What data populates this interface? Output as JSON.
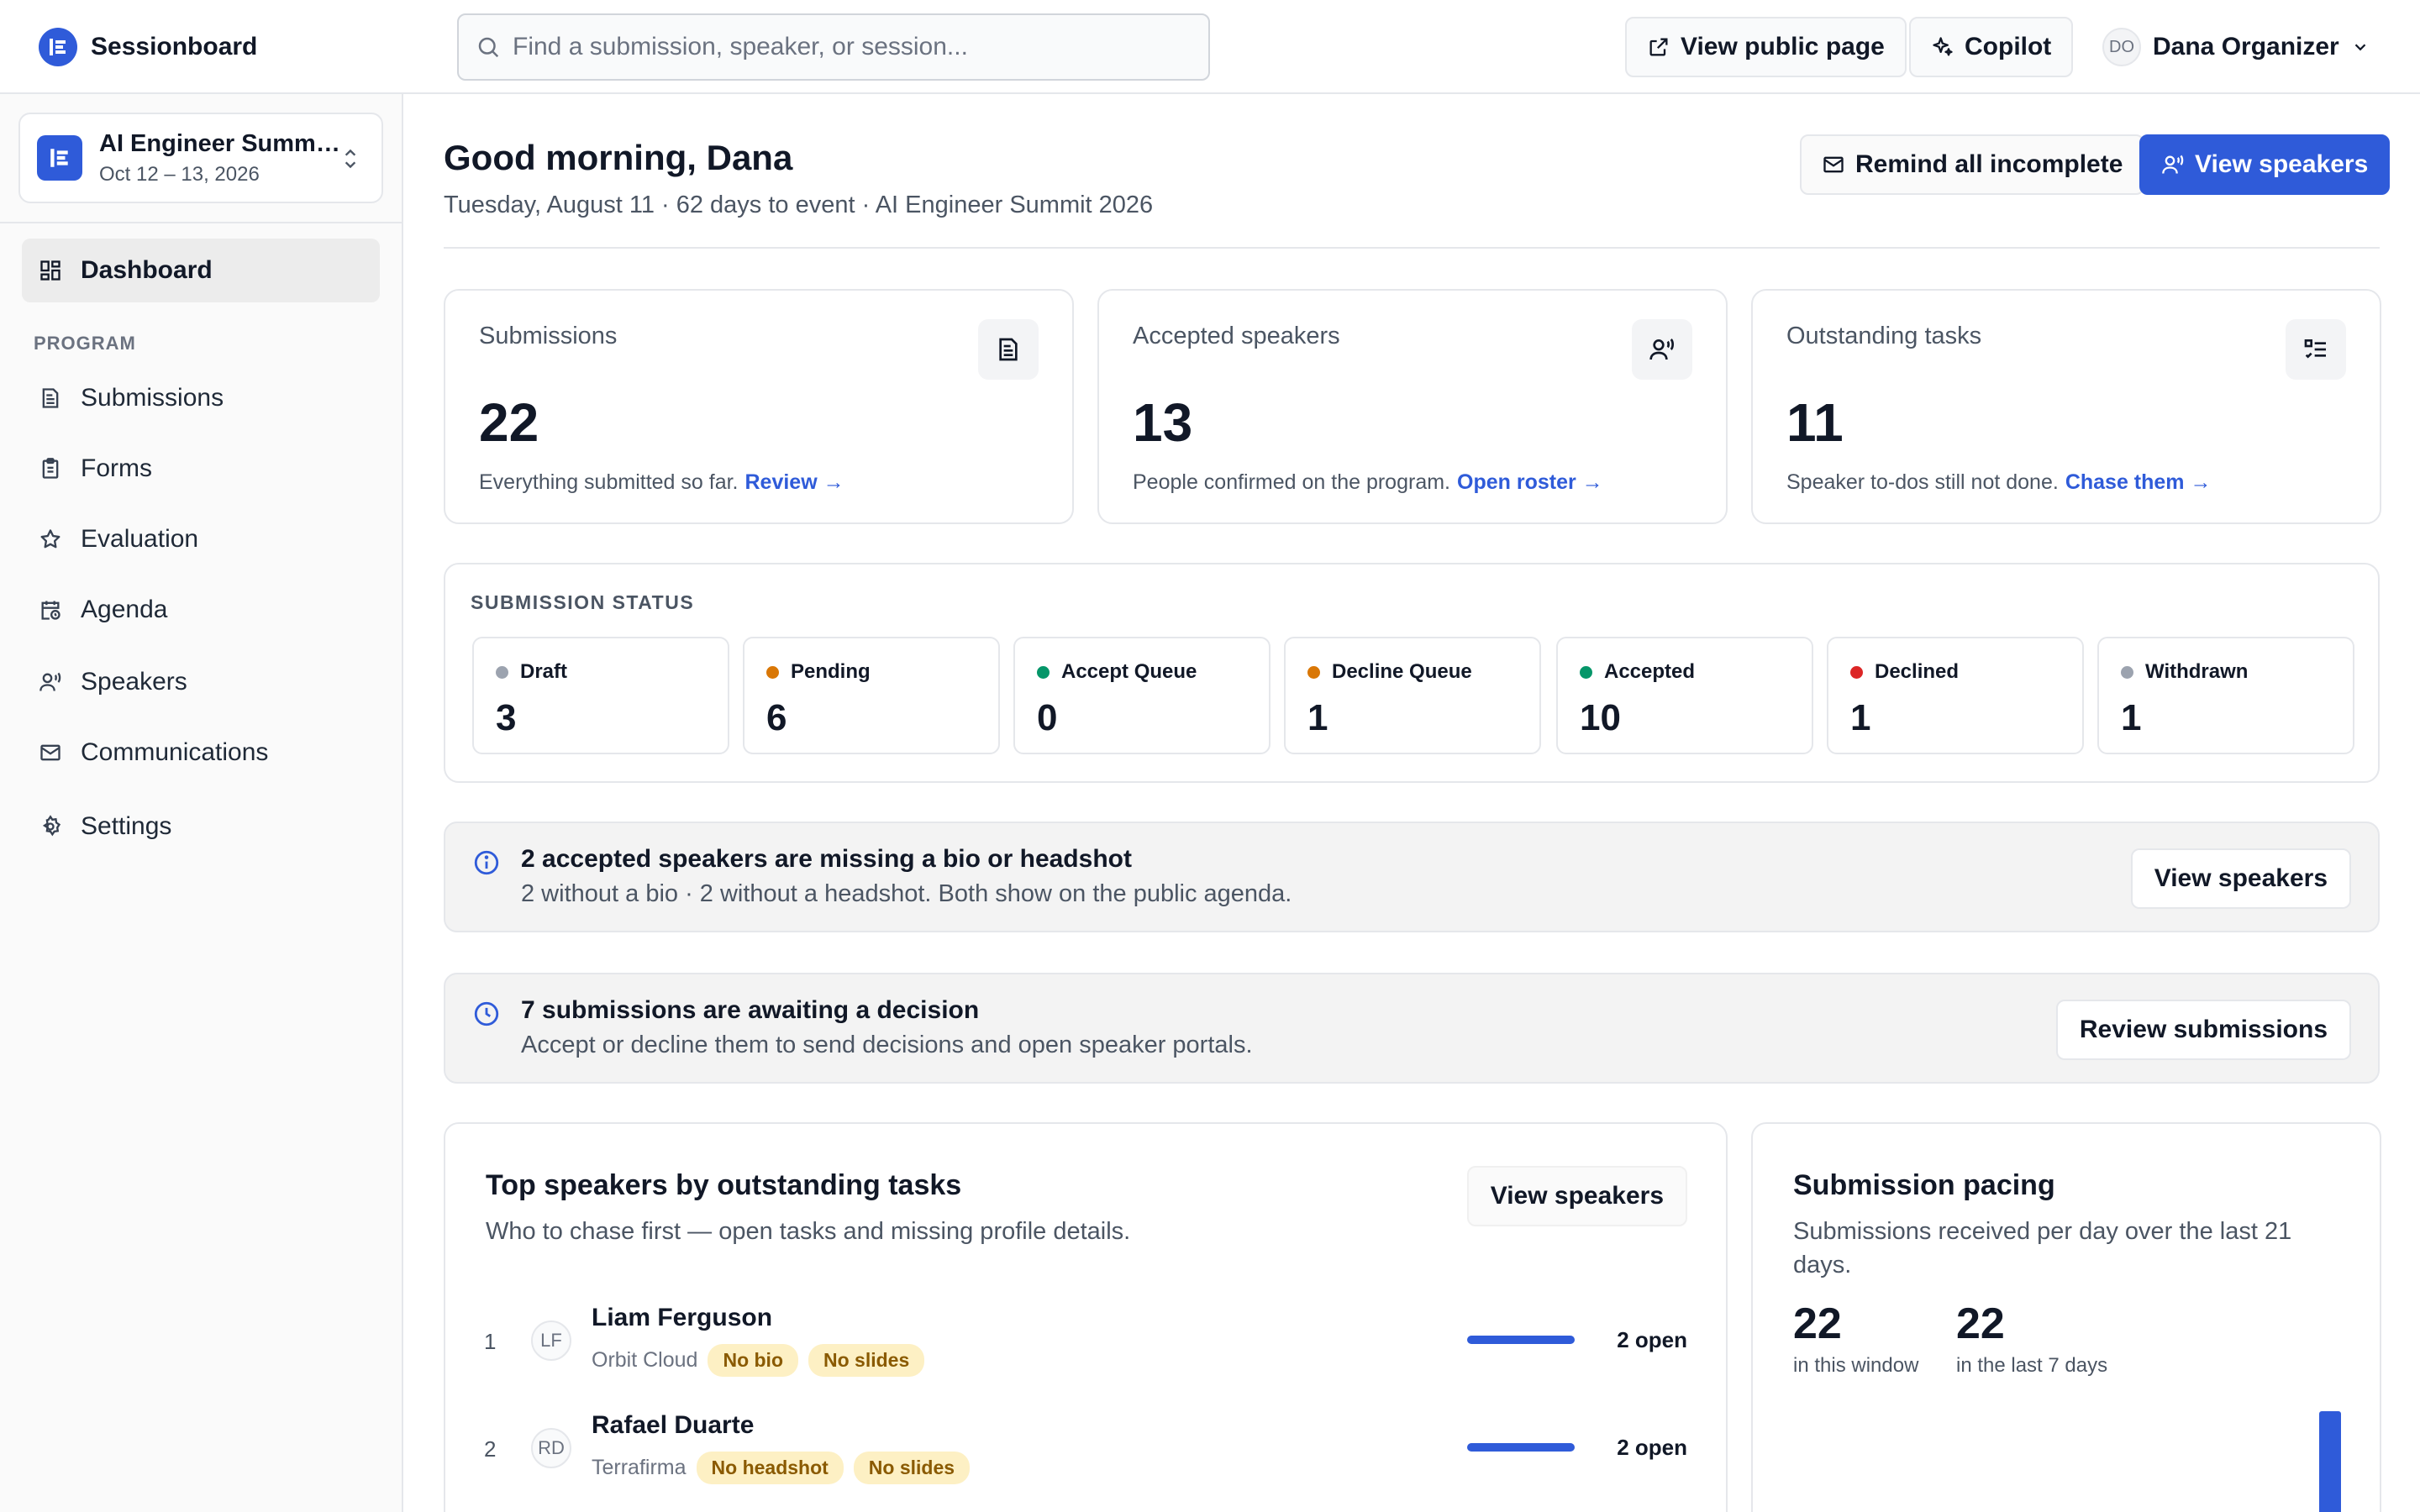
{
  "app": {
    "name": "Sessionboard"
  },
  "search": {
    "placeholder": "Find a submission, speaker, or session..."
  },
  "topbar": {
    "public_page_label": "View public page",
    "copilot_label": "Copilot",
    "user_initials": "DO",
    "user_name": "Dana Organizer"
  },
  "event": {
    "name": "AI Engineer Summit 2026",
    "dates": "Oct 12 – 13, 2026"
  },
  "sidebar": {
    "dashboard": "Dashboard",
    "section_label": "PROGRAM",
    "items": [
      {
        "label": "Submissions",
        "icon": "file-text-icon"
      },
      {
        "label": "Forms",
        "icon": "clipboard-icon"
      },
      {
        "label": "Evaluation",
        "icon": "star-icon"
      },
      {
        "label": "Agenda",
        "icon": "calendar-clock-icon"
      },
      {
        "label": "Speakers",
        "icon": "speaker-icon"
      },
      {
        "label": "Communications",
        "icon": "mail-icon"
      },
      {
        "label": "Settings",
        "icon": "gear-icon"
      }
    ]
  },
  "header": {
    "greeting": "Good morning, Dana",
    "subline": "Tuesday, August 11 · 62 days to event · AI Engineer Summit 2026",
    "remind_label": "Remind all incomplete",
    "view_speakers_label": "View speakers"
  },
  "stats": [
    {
      "title": "Submissions",
      "value": "22",
      "desc": "Everything submitted so far.",
      "link": "Review →",
      "icon": "file-text-icon"
    },
    {
      "title": "Accepted speakers",
      "value": "13",
      "desc": "People confirmed on the program.",
      "link": "Open roster →",
      "icon": "speaker-icon"
    },
    {
      "title": "Outstanding tasks",
      "value": "11",
      "desc": "Speaker to-dos still not done.",
      "link": "Chase them →",
      "icon": "task-list-icon"
    }
  ],
  "submission_status": {
    "heading": "SUBMISSION STATUS",
    "items": [
      {
        "label": "Draft",
        "count": "3",
        "color": "#9ca3af"
      },
      {
        "label": "Pending",
        "count": "6",
        "color": "#d97706"
      },
      {
        "label": "Accept Queue",
        "count": "0",
        "color": "#059669"
      },
      {
        "label": "Decline Queue",
        "count": "1",
        "color": "#d97706"
      },
      {
        "label": "Accepted",
        "count": "10",
        "color": "#059669"
      },
      {
        "label": "Declined",
        "count": "1",
        "color": "#dc2626"
      },
      {
        "label": "Withdrawn",
        "count": "1",
        "color": "#9ca3af"
      }
    ]
  },
  "alerts": [
    {
      "title": "2 accepted speakers are missing a bio or headshot",
      "body": "2 without a bio · 2 without a headshot. Both show on the public agenda.",
      "button": "View speakers",
      "icon": "info-icon"
    },
    {
      "title": "7 submissions are awaiting a decision",
      "body": "Accept or decline them to send decisions and open speaker portals.",
      "button": "Review submissions",
      "icon": "clock-icon"
    }
  ],
  "top_speakers": {
    "title": "Top speakers by outstanding tasks",
    "subtitle": "Who to chase first — open tasks and missing profile details.",
    "button": "View speakers",
    "rows": [
      {
        "rank": "1",
        "initials": "LF",
        "name": "Liam Ferguson",
        "company": "Orbit Cloud",
        "tags": [
          "No bio",
          "No slides"
        ],
        "open": "2 open",
        "progress": 1.0
      },
      {
        "rank": "2",
        "initials": "RD",
        "name": "Rafael Duarte",
        "company": "Terrafirma",
        "tags": [
          "No headshot",
          "No slides"
        ],
        "open": "2 open",
        "progress": 1.0
      }
    ]
  },
  "pacing": {
    "title": "Submission pacing",
    "subtitle": "Submissions received per day over the last 21 days.",
    "window_value": "22",
    "window_label": "in this window",
    "week_value": "22",
    "week_label": "in the last 7 days",
    "accent": "#2f5bd9"
  },
  "colors": {
    "accent": "#2f5bd9",
    "tag_bg": "#fdf0c4",
    "tag_text": "#8a5a00"
  }
}
